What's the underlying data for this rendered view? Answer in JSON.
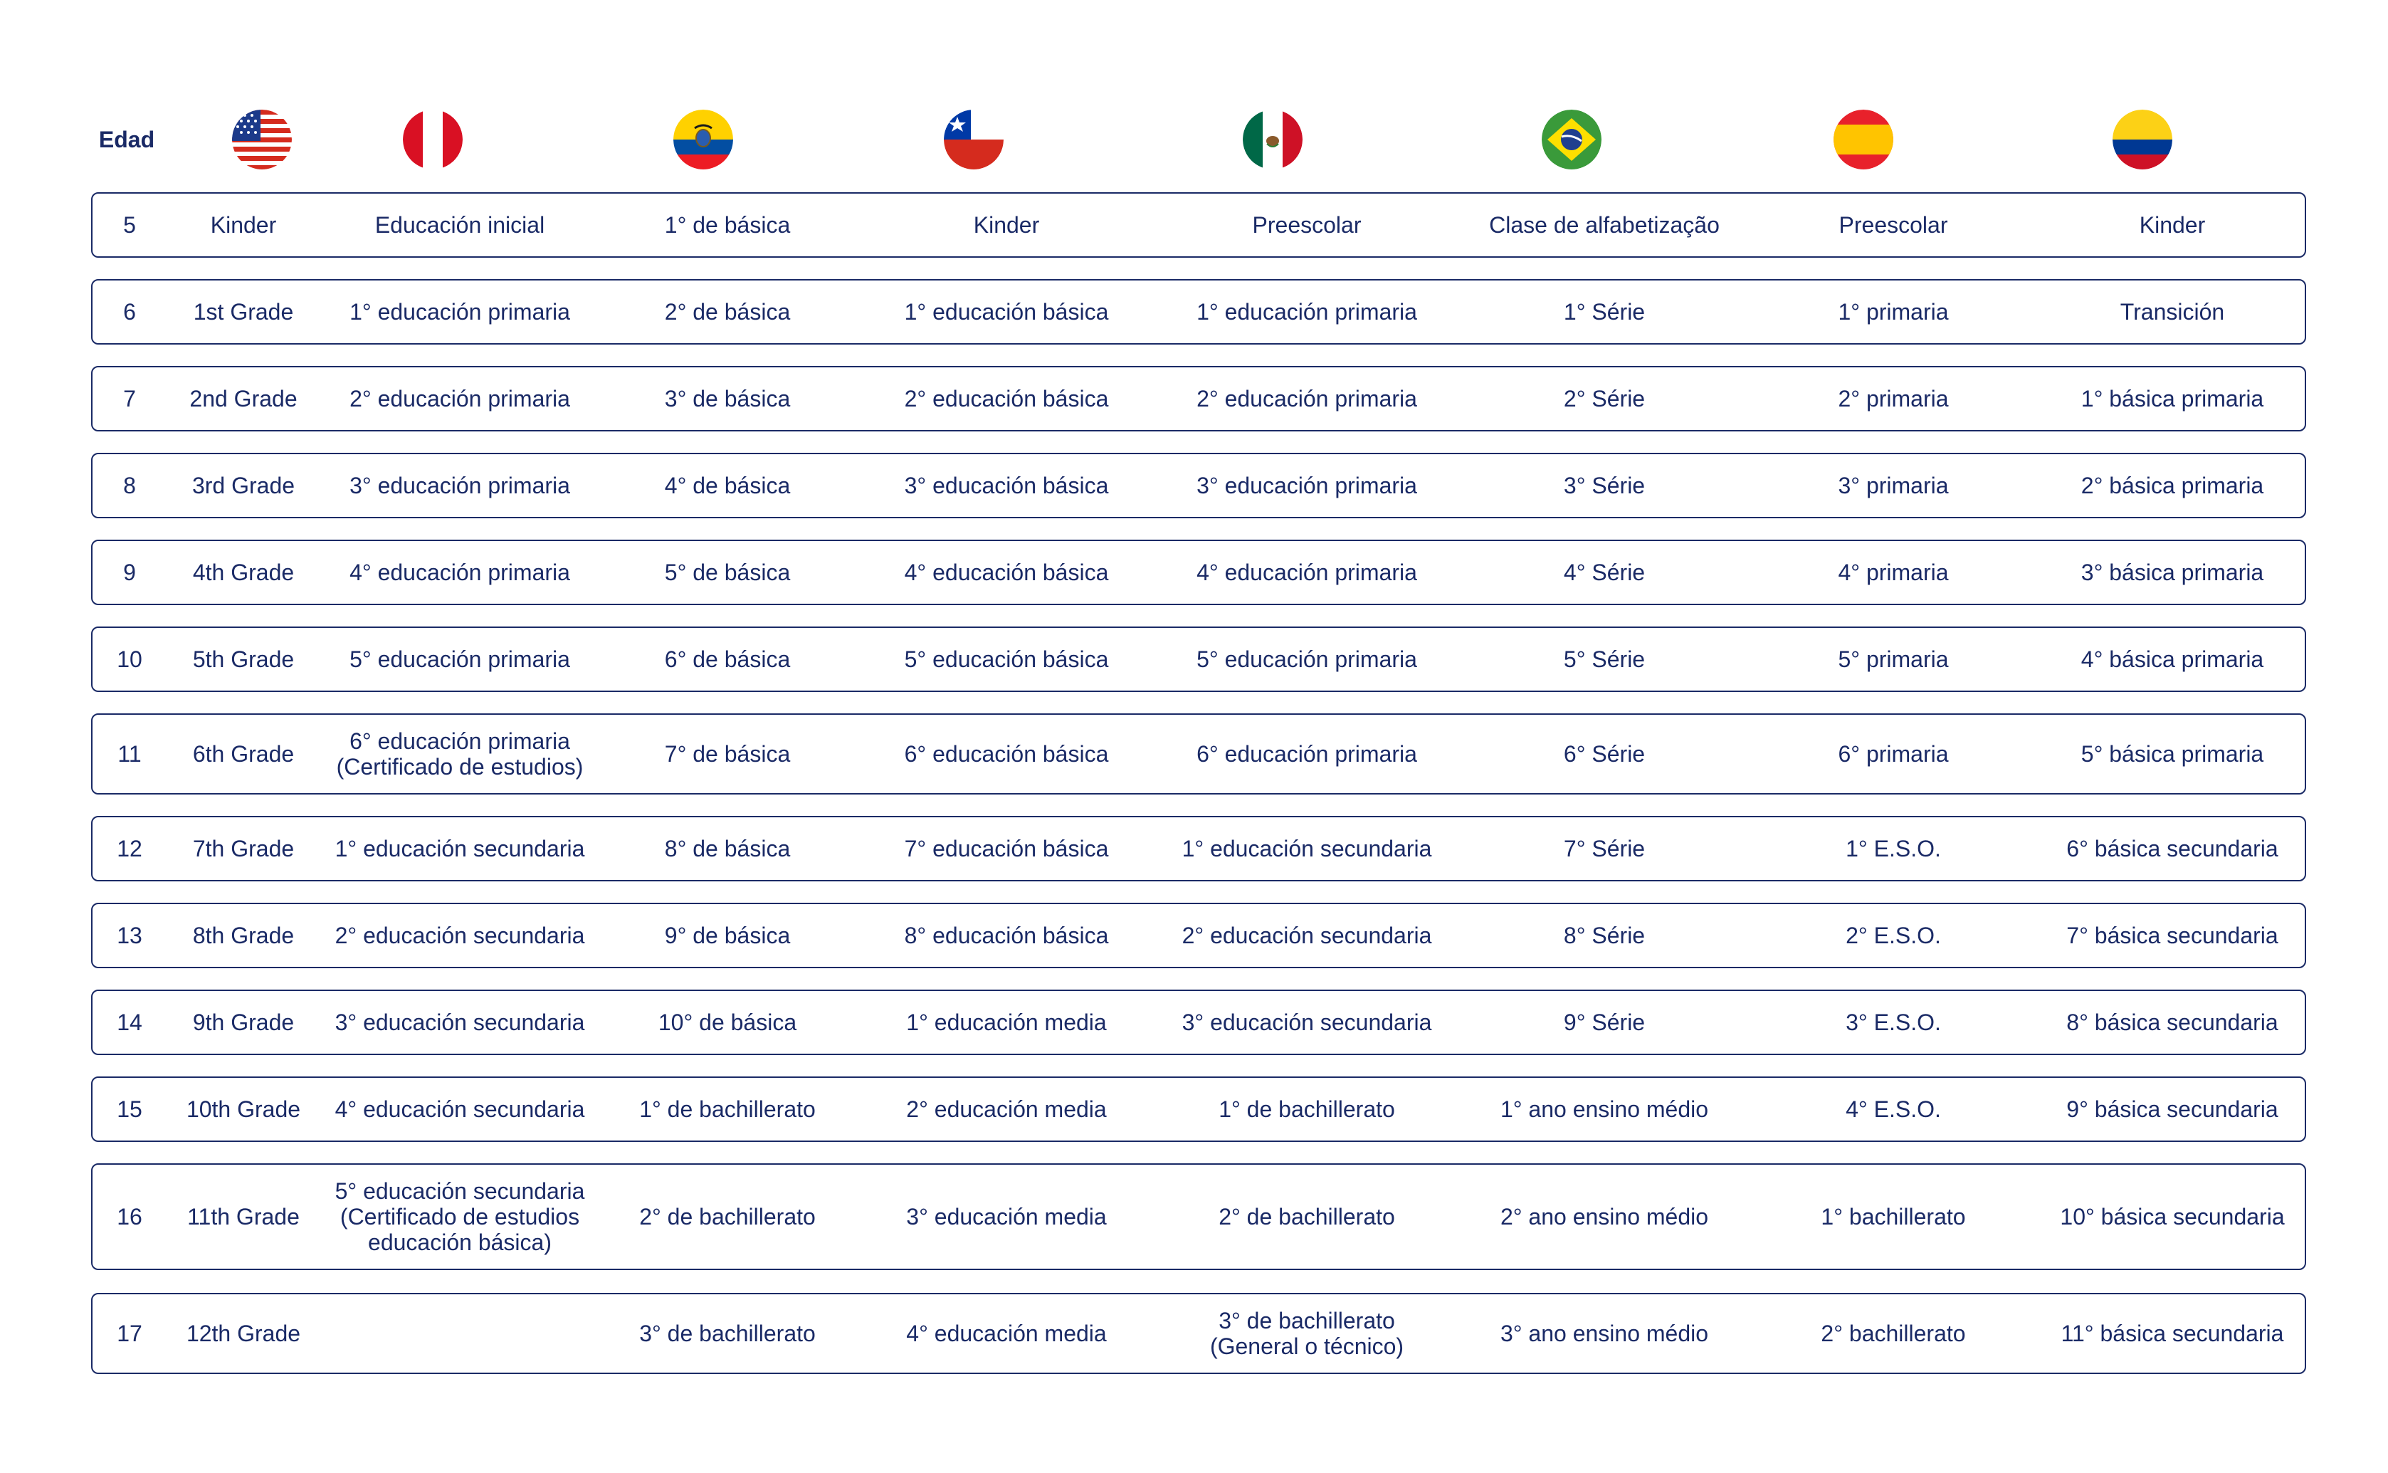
{
  "header": {
    "age_label": "Edad",
    "flags": [
      {
        "country": "USA",
        "icon": "usa-flag-icon"
      },
      {
        "country": "Peru",
        "icon": "peru-flag-icon"
      },
      {
        "country": "Ecuador",
        "icon": "ecuador-flag-icon"
      },
      {
        "country": "Chile",
        "icon": "chile-flag-icon"
      },
      {
        "country": "Mexico",
        "icon": "mexico-flag-icon"
      },
      {
        "country": "Brazil",
        "icon": "brazil-flag-icon"
      },
      {
        "country": "Spain",
        "icon": "spain-flag-icon"
      },
      {
        "country": "Colombia",
        "icon": "colombia-flag-icon"
      }
    ]
  },
  "rows": [
    [
      "5",
      "Kinder",
      "Educación inicial",
      "1° de básica",
      "Kinder",
      "Preescolar",
      "Clase de alfabetização",
      "Preescolar",
      "Kinder"
    ],
    [
      "6",
      "1st Grade",
      "1° educación primaria",
      "2° de básica",
      "1° educación básica",
      "1° educación primaria",
      "1° Série",
      "1° primaria",
      "Transición"
    ],
    [
      "7",
      "2nd Grade",
      "2° educación primaria",
      "3° de básica",
      "2° educación básica",
      "2° educación primaria",
      "2° Série",
      "2° primaria",
      "1° básica primaria"
    ],
    [
      "8",
      "3rd Grade",
      "3° educación primaria",
      "4° de básica",
      "3° educación básica",
      "3° educación primaria",
      "3° Série",
      "3° primaria",
      "2° básica primaria"
    ],
    [
      "9",
      "4th Grade",
      "4° educación primaria",
      "5° de básica",
      "4° educación básica",
      "4° educación primaria",
      "4° Série",
      "4° primaria",
      "3° básica primaria"
    ],
    [
      "10",
      "5th Grade",
      "5° educación primaria",
      "6° de básica",
      "5° educación básica",
      "5° educación primaria",
      "5° Série",
      "5° primaria",
      "4° básica primaria"
    ],
    [
      "11",
      "6th Grade",
      "6° educación primaria\n(Certificado de estudios)",
      "7° de básica",
      "6° educación básica",
      "6° educación primaria",
      "6° Série",
      "6° primaria",
      "5° básica primaria"
    ],
    [
      "12",
      "7th Grade",
      "1° educación secundaria",
      "8° de básica",
      "7° educación básica",
      "1° educación secundaria",
      "7° Série",
      "1° E.S.O.",
      "6° básica secundaria"
    ],
    [
      "13",
      "8th Grade",
      "2° educación secundaria",
      "9° de básica",
      "8° educación básica",
      "2° educación secundaria",
      "8° Série",
      "2° E.S.O.",
      "7° básica secundaria"
    ],
    [
      "14",
      "9th Grade",
      "3° educación secundaria",
      "10° de básica",
      "1° educación media",
      "3° educación secundaria",
      "9° Série",
      "3° E.S.O.",
      "8° básica secundaria"
    ],
    [
      "15",
      "10th Grade",
      "4° educación secundaria",
      "1° de bachillerato",
      "2° educación media",
      "1° de bachillerato",
      "1° ano ensino médio",
      "4° E.S.O.",
      "9° básica secundaria"
    ],
    [
      "16",
      "11th Grade",
      "5° educación secundaria\n(Certificado de estudios\neducación básica)",
      "2° de bachillerato",
      "3° educación media",
      "2° de bachillerato",
      "2° ano ensino médio",
      "1° bachillerato",
      "10° básica secundaria"
    ],
    [
      "17",
      "12th Grade",
      "",
      "3° de bachillerato",
      "4° educación media",
      "3° de bachillerato\n(General o técnico)",
      "3° ano ensino médio",
      "2° bachillerato",
      "11° básica secundaria"
    ]
  ],
  "colors": {
    "text": "#1a2a66",
    "border": "#1a2a66",
    "background": "#ffffff"
  }
}
